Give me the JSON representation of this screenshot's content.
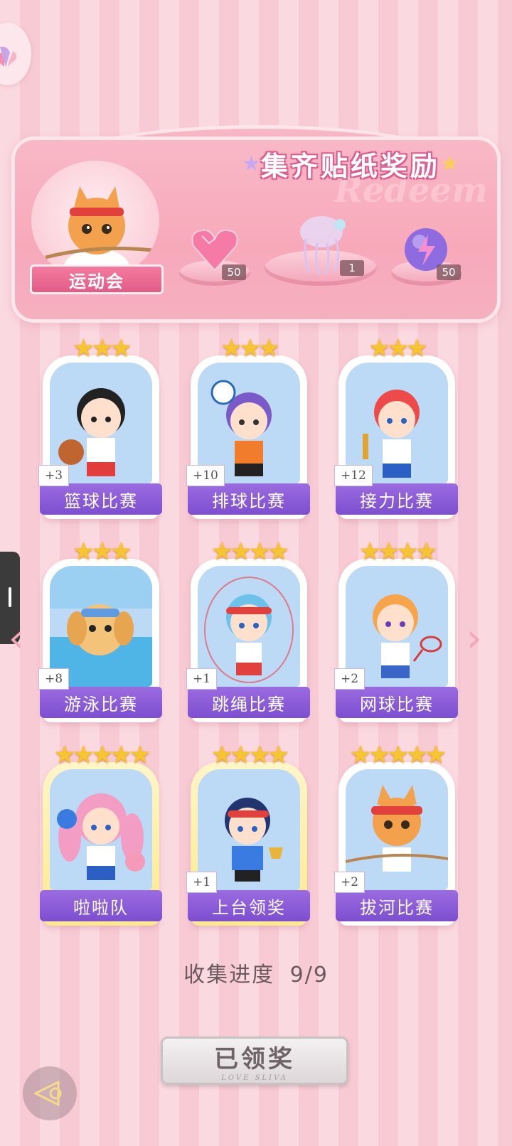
{
  "banner": {
    "title": "集齐贴纸奖励",
    "watermark": "Redeem",
    "event_name": "运动会",
    "rewards": [
      {
        "icon": "pink-heart-gem-icon",
        "count": "50"
      },
      {
        "icon": "crystal-jellyfish-icon",
        "count": "1"
      },
      {
        "icon": "purple-lightning-orb-icon",
        "count": "50"
      }
    ]
  },
  "cards": [
    {
      "label": "篮球比赛",
      "bonus": "+3",
      "stars": 3,
      "gold": false
    },
    {
      "label": "排球比赛",
      "bonus": "+10",
      "stars": 3,
      "gold": false
    },
    {
      "label": "接力比赛",
      "bonus": "+12",
      "stars": 3,
      "gold": false
    },
    {
      "label": "游泳比赛",
      "bonus": "+8",
      "stars": 3,
      "gold": false
    },
    {
      "label": "跳绳比赛",
      "bonus": "+1",
      "stars": 4,
      "gold": false
    },
    {
      "label": "网球比赛",
      "bonus": "+2",
      "stars": 4,
      "gold": false
    },
    {
      "label": "啦啦队",
      "bonus": "",
      "stars": 5,
      "gold": true
    },
    {
      "label": "上台领奖",
      "bonus": "+1",
      "stars": 4,
      "gold": true
    },
    {
      "label": "拔河比赛",
      "bonus": "+2",
      "stars": 5,
      "gold": false
    }
  ],
  "progress": {
    "label": "收集进度",
    "value": "9/9"
  },
  "claim_button": {
    "label": "已领奖",
    "sub": "LOVE SLIVA"
  },
  "colors": {
    "accent_purple": "#8a5bd8",
    "star_gold": "#f7c531",
    "banner_pink": "#f7a9ba"
  }
}
